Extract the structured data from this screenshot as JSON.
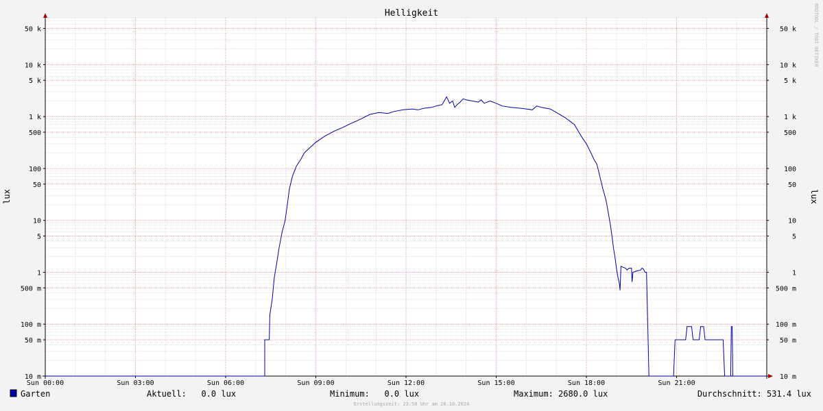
{
  "chart_data": {
    "type": "line",
    "title": "Helligkeit",
    "ylabel": "lux",
    "watermark": "RRDTOOL / TOBI OETIKER",
    "y_scale": "log",
    "ylim": [
      0.01,
      80000
    ],
    "xlim": [
      "Sun 00:00",
      "Sun 24:00"
    ],
    "x_ticks": [
      {
        "label": "Sun 00:00",
        "hour": 0
      },
      {
        "label": "Sun 03:00",
        "hour": 3
      },
      {
        "label": "Sun 06:00",
        "hour": 6
      },
      {
        "label": "Sun 09:00",
        "hour": 9
      },
      {
        "label": "Sun 12:00",
        "hour": 12
      },
      {
        "label": "Sun 15:00",
        "hour": 15
      },
      {
        "label": "Sun 18:00",
        "hour": 18
      },
      {
        "label": "Sun 21:00",
        "hour": 21
      }
    ],
    "y_ticks": [
      {
        "label": "50 k",
        "value": 50000
      },
      {
        "label": "10 k",
        "value": 10000
      },
      {
        "label": "5 k",
        "value": 5000
      },
      {
        "label": "1 k",
        "value": 1000
      },
      {
        "label": "500",
        "value": 500
      },
      {
        "label": "100",
        "value": 100
      },
      {
        "label": "50",
        "value": 50
      },
      {
        "label": "10",
        "value": 10
      },
      {
        "label": "5",
        "value": 5
      },
      {
        "label": "1",
        "value": 1
      },
      {
        "label": "500 m",
        "value": 0.5
      },
      {
        "label": "100 m",
        "value": 0.1
      },
      {
        "label": "50 m",
        "value": 0.05
      },
      {
        "label": "10 m",
        "value": 0.01
      }
    ],
    "grid": true,
    "series": [
      {
        "name": "Garten",
        "color": "#0000aa",
        "points": [
          [
            0,
            0.01
          ],
          [
            7.3,
            0.01
          ],
          [
            7.3,
            0.05
          ],
          [
            7.45,
            0.05
          ],
          [
            7.47,
            0.15
          ],
          [
            7.55,
            0.3
          ],
          [
            7.62,
            0.8
          ],
          [
            7.7,
            1.5
          ],
          [
            7.78,
            3
          ],
          [
            7.88,
            6
          ],
          [
            7.98,
            10
          ],
          [
            8.05,
            20
          ],
          [
            8.12,
            40
          ],
          [
            8.22,
            70
          ],
          [
            8.35,
            110
          ],
          [
            8.5,
            150
          ],
          [
            8.62,
            200
          ],
          [
            8.8,
            250
          ],
          [
            9.0,
            320
          ],
          [
            9.3,
            420
          ],
          [
            9.6,
            520
          ],
          [
            9.9,
            620
          ],
          [
            10.2,
            750
          ],
          [
            10.5,
            900
          ],
          [
            10.8,
            1100
          ],
          [
            11.1,
            1200
          ],
          [
            11.4,
            1150
          ],
          [
            11.6,
            1250
          ],
          [
            11.9,
            1350
          ],
          [
            12.2,
            1400
          ],
          [
            12.4,
            1350
          ],
          [
            12.6,
            1450
          ],
          [
            12.85,
            1500
          ],
          [
            13.0,
            1600
          ],
          [
            13.2,
            1700
          ],
          [
            13.35,
            2400
          ],
          [
            13.45,
            1800
          ],
          [
            13.55,
            2000
          ],
          [
            13.62,
            1500
          ],
          [
            13.7,
            1700
          ],
          [
            13.8,
            1900
          ],
          [
            13.9,
            2200
          ],
          [
            14.0,
            2100
          ],
          [
            14.2,
            2000
          ],
          [
            14.4,
            1900
          ],
          [
            14.5,
            2100
          ],
          [
            14.6,
            1800
          ],
          [
            14.8,
            2000
          ],
          [
            15.0,
            1800
          ],
          [
            15.2,
            1600
          ],
          [
            15.5,
            1500
          ],
          [
            15.8,
            1450
          ],
          [
            16.0,
            1400
          ],
          [
            16.2,
            1350
          ],
          [
            16.35,
            1600
          ],
          [
            16.5,
            1500
          ],
          [
            16.8,
            1400
          ],
          [
            17.0,
            1200
          ],
          [
            17.3,
            950
          ],
          [
            17.6,
            700
          ],
          [
            17.85,
            400
          ],
          [
            18.0,
            300
          ],
          [
            18.15,
            200
          ],
          [
            18.25,
            150
          ],
          [
            18.35,
            120
          ],
          [
            18.45,
            70
          ],
          [
            18.55,
            40
          ],
          [
            18.65,
            25
          ],
          [
            18.72,
            15
          ],
          [
            18.8,
            8
          ],
          [
            18.85,
            5
          ],
          [
            18.9,
            3
          ],
          [
            18.95,
            2
          ],
          [
            19.0,
            1.2
          ],
          [
            19.05,
            0.8
          ],
          [
            19.1,
            0.6
          ],
          [
            19.12,
            0.45
          ],
          [
            19.15,
            1.3
          ],
          [
            19.3,
            1.2
          ],
          [
            19.35,
            1.1
          ],
          [
            19.42,
            1.2
          ],
          [
            19.5,
            1.2
          ],
          [
            19.52,
            0.65
          ],
          [
            19.55,
            1.0
          ],
          [
            19.65,
            1.05
          ],
          [
            19.8,
            1.1
          ],
          [
            19.85,
            1.2
          ],
          [
            19.9,
            1.15
          ],
          [
            19.95,
            1.0
          ],
          [
            20.0,
            1.0
          ],
          [
            20.08,
            0.01
          ],
          [
            20.9,
            0.01
          ],
          [
            20.95,
            0.05
          ],
          [
            21.3,
            0.05
          ],
          [
            21.35,
            0.09
          ],
          [
            21.5,
            0.09
          ],
          [
            21.55,
            0.05
          ],
          [
            21.75,
            0.05
          ],
          [
            21.8,
            0.09
          ],
          [
            21.9,
            0.09
          ],
          [
            21.95,
            0.05
          ],
          [
            22.55,
            0.05
          ],
          [
            22.6,
            0.01
          ],
          [
            22.8,
            0.01
          ],
          [
            22.82,
            0.09
          ],
          [
            22.85,
            0.09
          ],
          [
            22.87,
            0.01
          ],
          [
            24.0,
            0.01
          ]
        ]
      }
    ]
  },
  "legend": {
    "series_name": "Garten",
    "swatch_color": "#0000aa",
    "current": "Aktuell:   0.0 lux",
    "minimum": "Minimum:   0.0 lux",
    "maximum": "Maximum: 2680.0 lux",
    "average": "Durchschnitt: 531.4 lux"
  },
  "footer": "Erstellungszeit: 23:58 Uhr am 20.10.2024"
}
